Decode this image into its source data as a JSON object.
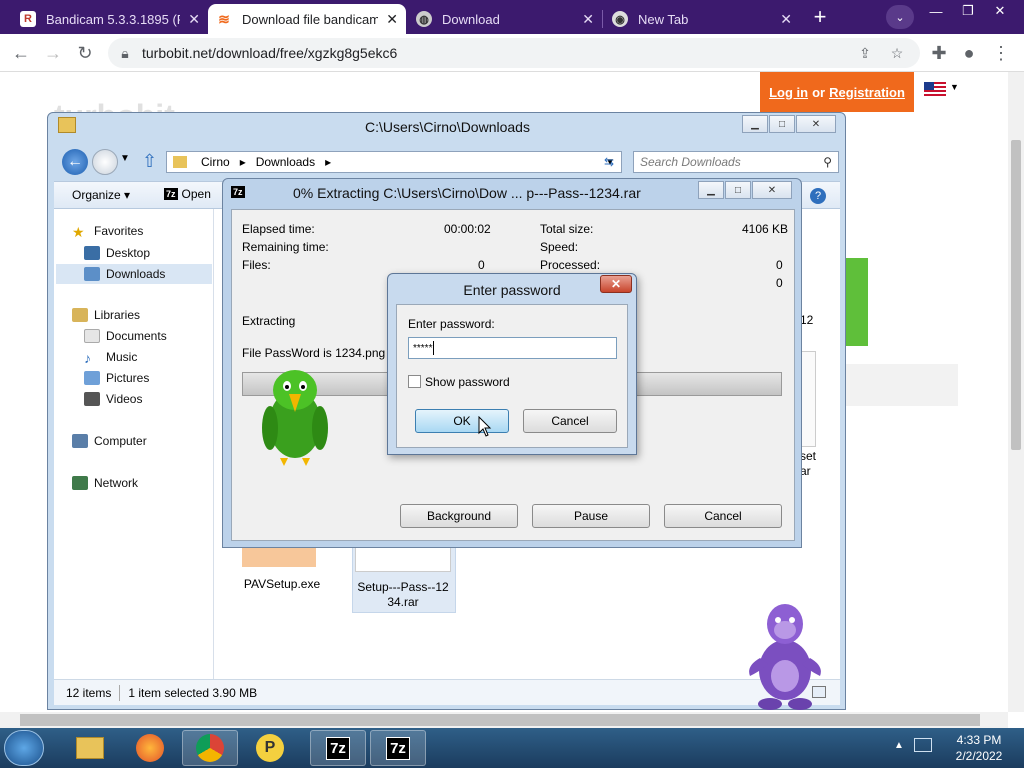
{
  "browser": {
    "tabs": [
      {
        "title": "Bandicam 5.3.3.1895 (Re",
        "favicon": "bandicam-icon"
      },
      {
        "title": "Download file bandicam_",
        "favicon": "turbobit-icon",
        "active": true
      },
      {
        "title": "Download",
        "favicon": "globe-icon"
      },
      {
        "title": "New Tab",
        "favicon": "chrome-icon"
      }
    ],
    "new_tab_label": "+",
    "url": "turbobit.net/download/free/xgzkg8g5ekc6"
  },
  "site": {
    "logo_text": "turbobit",
    "login_link": "Log in",
    "or_text": "or",
    "registration_link": "Registration"
  },
  "explorer": {
    "title": "C:\\Users\\Cirno\\Downloads",
    "breadcrumb": [
      "Cirno",
      "Downloads"
    ],
    "search_placeholder": "Search Downloads",
    "organize": "Organize",
    "open": "Open",
    "nav": {
      "favorites": "Favorites",
      "desktop": "Desktop",
      "downloads": "Downloads",
      "libraries": "Libraries",
      "documents": "Documents",
      "music": "Music",
      "pictures": "Pictures",
      "videos": "Videos",
      "computer": "Computer",
      "network": "Network"
    },
    "files": [
      {
        "name": "PAVSetup.exe"
      },
      {
        "name_line1": "Setup---Pass--12",
        "name_line2": "34.rar"
      }
    ],
    "partial_texts": {
      "right_12": "12",
      "right_set": "set",
      "right_ar": "ar"
    },
    "status": {
      "items": "12 items",
      "selected": "1 item selected  3.90 MB"
    }
  },
  "zip_dialog": {
    "title": "0% Extracting C:\\Users\\Cirno\\Dow ... p---Pass--1234.rar",
    "elapsed_label": "Elapsed time:",
    "elapsed_value": "00:00:02",
    "remaining_label": "Remaining time:",
    "files_label": "Files:",
    "files_value": "0",
    "total_size_label": "Total size:",
    "total_size_value": "4106 KB",
    "speed_label": "Speed:",
    "processed_label": "Processed:",
    "processed_value": "0",
    "extra_value": "0",
    "extracting_label": "Extracting",
    "current_file": "File PassWord is 1234.png",
    "progress": 0,
    "background_btn": "Background",
    "pause_btn": "Pause",
    "cancel_btn": "Cancel"
  },
  "password_dialog": {
    "title": "Enter password",
    "field_label": "Enter password:",
    "field_value": "*****",
    "show_password_label": "Show password",
    "ok_btn": "OK",
    "cancel_btn": "Cancel"
  },
  "taskbar": {
    "apps": [
      "explorer-icon",
      "firefox-icon",
      "chrome-icon",
      "pdf-icon",
      "7zip-icon",
      "7zip-icon"
    ],
    "time": "4:33 PM",
    "date": "2/2/2022"
  },
  "colors": {
    "tabbar": "#3c1a6e",
    "accent": "#f0691c",
    "taskbar": "#1b3c5e"
  }
}
